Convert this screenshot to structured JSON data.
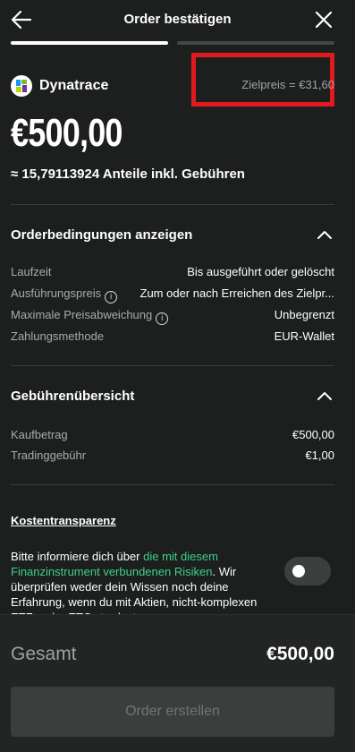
{
  "header": {
    "title": "Order bestätigen"
  },
  "progress": {
    "step": 1,
    "total_steps": 2
  },
  "instrument": {
    "name": "Dynatrace",
    "target_price": "Zielpreis = €31,60"
  },
  "order": {
    "amount": "€500,00",
    "shares": "≈ 15,79113924 Anteile inkl. Gebühren"
  },
  "conditions": {
    "title": "Orderbedingungen anzeigen",
    "rows": [
      {
        "label": "Laufzeit",
        "value": "Bis ausgeführt oder gelöscht"
      },
      {
        "label": "Ausführungspreis",
        "value": "Zum oder nach Erreichen des Zielpr..."
      },
      {
        "label": "Maximale Preisabweichung",
        "value": "Unbegrenzt"
      },
      {
        "label": "Zahlungsmethode",
        "value": "EUR-Wallet"
      }
    ]
  },
  "fees": {
    "title": "Gebührenübersicht",
    "rows": [
      {
        "label": "Kaufbetrag",
        "value": "€500,00"
      },
      {
        "label": "Tradinggebühr",
        "value": "€1,00"
      }
    ]
  },
  "transparency": {
    "link": "Kostentransparenz",
    "text_before": "Bitte informiere dich über ",
    "risk_link": "die mit diesem Finanzinstrument verbundenen Risiken",
    "text_after": ". Wir überprüfen weder dein Wissen noch deine Erfahrung, wenn du mit Aktien, nicht-komplexen ETFs oder ETCs tradest.",
    "toggle_on": false
  },
  "footer": {
    "total_label": "Gesamt",
    "total_value": "€500,00",
    "button_label": "Order erstellen"
  },
  "colors": {
    "background": "#1c1f1e",
    "accent_green": "#3fcf8e",
    "highlight_red": "#e21a1f",
    "disabled_button": "#3a3e3c"
  },
  "icons": [
    "back-arrow-icon",
    "close-icon",
    "dynatrace-logo-icon",
    "chevron-up-icon",
    "info-icon"
  ]
}
